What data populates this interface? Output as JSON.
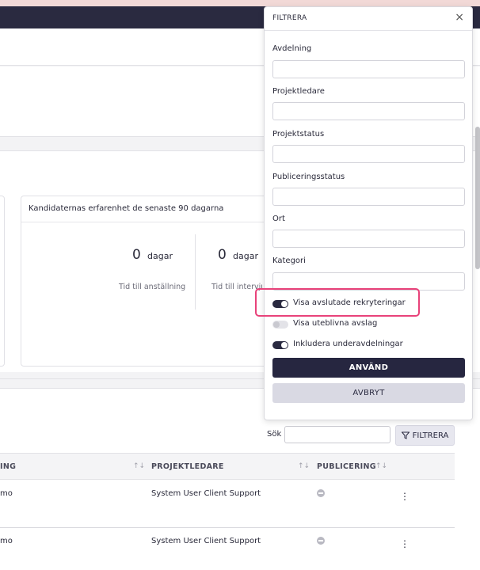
{
  "card": {
    "title": "Kandidaternas erfarenhet de senaste 90 dagarna",
    "metrics": [
      {
        "value": "0",
        "unit": "dagar",
        "label": "Tid till anställning"
      },
      {
        "value": "0",
        "unit": "dagar",
        "label": "Tid till intervju"
      }
    ]
  },
  "search": {
    "label": "Sök",
    "value": ""
  },
  "filter_button": {
    "label": "FILTRERA"
  },
  "table": {
    "columns": [
      "ING",
      "PROJEKTLEDARE",
      "PUBLICERING"
    ],
    "rows": [
      {
        "name": "mo",
        "manager": "System User Client Support"
      },
      {
        "name": "mo",
        "manager": "System User Client Support"
      }
    ]
  },
  "filter_panel": {
    "title": "FILTRERA",
    "fields": [
      {
        "label": "Avdelning",
        "value": ""
      },
      {
        "label": "Projektledare",
        "value": ""
      },
      {
        "label": "Projektstatus",
        "value": ""
      },
      {
        "label": "Publiceringsstatus",
        "value": ""
      },
      {
        "label": "Ort",
        "value": ""
      },
      {
        "label": "Kategori",
        "value": ""
      }
    ],
    "toggles": [
      {
        "label": "Visa avslutade rekryteringar",
        "on": true
      },
      {
        "label": "Visa uteblivna avslag",
        "on": false
      },
      {
        "label": "Inkludera underavdelningar",
        "on": true
      }
    ],
    "apply_label": "ANVÄND",
    "cancel_label": "AVBRYT"
  },
  "colors": {
    "accent": "#262640",
    "highlight": "#e8427a"
  }
}
